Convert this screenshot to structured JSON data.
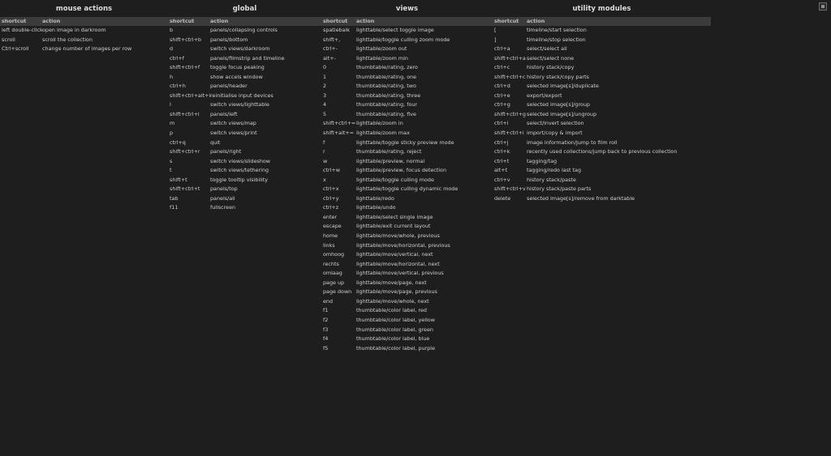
{
  "header": {
    "shortcut": "shortcut",
    "action": "action"
  },
  "sections": [
    {
      "title": "mouse actions",
      "rows": [
        [
          "left double-click",
          "open image in darkroom"
        ],
        [
          "scroll",
          "scroll the collection"
        ],
        [
          "Ctrl+scroll",
          "change number of images per row"
        ]
      ]
    },
    {
      "title": "global",
      "rows": [
        [
          "b",
          "panels/collapsing controls"
        ],
        [
          "shift+ctrl+b",
          "panels/bottom"
        ],
        [
          "d",
          "switch views/darkroom"
        ],
        [
          "ctrl+f",
          "panels/filmstrip and timeline"
        ],
        [
          "shift+ctrl+f",
          "toggle focus peaking"
        ],
        [
          "h",
          "show accels window"
        ],
        [
          "ctrl+h",
          "panels/header"
        ],
        [
          "shift+ctrl+alt+i",
          "reinitialise input devices"
        ],
        [
          "l",
          "switch views/lighttable"
        ],
        [
          "shift+ctrl+l",
          "panels/left"
        ],
        [
          "m",
          "switch views/map"
        ],
        [
          "p",
          "switch views/print"
        ],
        [
          "ctrl+q",
          "quit"
        ],
        [
          "shift+ctrl+r",
          "panels/right"
        ],
        [
          "s",
          "switch views/slideshow"
        ],
        [
          "t",
          "switch views/tethering"
        ],
        [
          "shift+t",
          "toggle tooltip visibility"
        ],
        [
          "shift+ctrl+t",
          "panels/top"
        ],
        [
          "tab",
          "panels/all"
        ],
        [
          "f11",
          "fullscreen"
        ]
      ]
    },
    {
      "title": "views",
      "rows": [
        [
          "spatiebalk",
          "lighttable/select toggle image"
        ],
        [
          "shift+,",
          "lighttable/toggle culling zoom mode"
        ],
        [
          "ctrl+-",
          "lighttable/zoom out"
        ],
        [
          "alt+-",
          "lighttable/zoom min"
        ],
        [
          "0",
          "thumbtable/rating, zero"
        ],
        [
          "1",
          "thumbtable/rating, one"
        ],
        [
          "2",
          "thumbtable/rating, two"
        ],
        [
          "3",
          "thumbtable/rating, three"
        ],
        [
          "4",
          "thumbtable/rating, four"
        ],
        [
          "5",
          "thumbtable/rating, five"
        ],
        [
          "shift+ctrl+=",
          "lighttable/zoom in"
        ],
        [
          "shift+alt+=",
          "lighttable/zoom max"
        ],
        [
          "f",
          "lighttable/toggle sticky preview mode"
        ],
        [
          "r",
          "thumbtable/rating, reject"
        ],
        [
          "w",
          "lighttable/preview, normal"
        ],
        [
          "ctrl+w",
          "lighttable/preview, focus detection"
        ],
        [
          "x",
          "lighttable/toggle culling mode"
        ],
        [
          "ctrl+x",
          "lighttable/toggle culling dynamic mode"
        ],
        [
          "ctrl+y",
          "lighttable/redo"
        ],
        [
          "ctrl+z",
          "lighttable/undo"
        ],
        [
          "enter",
          "lighttable/select single image"
        ],
        [
          "escape",
          "lighttable/exit current layout"
        ],
        [
          "home",
          "lighttable/move/whole, previous"
        ],
        [
          "links",
          "lighttable/move/horizontal, previous"
        ],
        [
          "omhoog",
          "lighttable/move/vertical, next"
        ],
        [
          "rechts",
          "lighttable/move/horizontal, next"
        ],
        [
          "omlaag",
          "lighttable/move/vertical, previous"
        ],
        [
          "page up",
          "lighttable/move/page, next"
        ],
        [
          "page down",
          "lighttable/move/page, previous"
        ],
        [
          "end",
          "lighttable/move/whole, next"
        ],
        [
          "f1",
          "thumbtable/color label, red"
        ],
        [
          "f2",
          "thumbtable/color label, yellow"
        ],
        [
          "f3",
          "thumbtable/color label, green"
        ],
        [
          "f4",
          "thumbtable/color label, blue"
        ],
        [
          "f5",
          "thumbtable/color label, purple"
        ]
      ]
    },
    {
      "title": "utility modules",
      "rows": [
        [
          "[",
          "timeline/start selection"
        ],
        [
          "]",
          "timeline/stop selection"
        ],
        [
          "ctrl+a",
          "select/select all"
        ],
        [
          "shift+ctrl+a",
          "select/select none"
        ],
        [
          "ctrl+c",
          "history stack/copy"
        ],
        [
          "shift+ctrl+c",
          "history stack/copy parts"
        ],
        [
          "ctrl+d",
          "selected image[s]/duplicate"
        ],
        [
          "ctrl+e",
          "export/export"
        ],
        [
          "ctrl+g",
          "selected image[s]/group"
        ],
        [
          "shift+ctrl+g",
          "selected image[s]/ungroup"
        ],
        [
          "ctrl+i",
          "select/invert selection"
        ],
        [
          "shift+ctrl+i",
          "import/copy & import"
        ],
        [
          "ctrl+j",
          "image information/jump to film roll"
        ],
        [
          "ctrl+k",
          "recently used collections/jump back to previous collection"
        ],
        [
          "ctrl+t",
          "tagging/tag"
        ],
        [
          "alt+t",
          "tagging/redo last tag"
        ],
        [
          "ctrl+v",
          "history stack/paste"
        ],
        [
          "shift+ctrl+v",
          "history stack/paste parts"
        ],
        [
          "delete",
          "selected image[s]/remove from darktable"
        ]
      ]
    }
  ]
}
